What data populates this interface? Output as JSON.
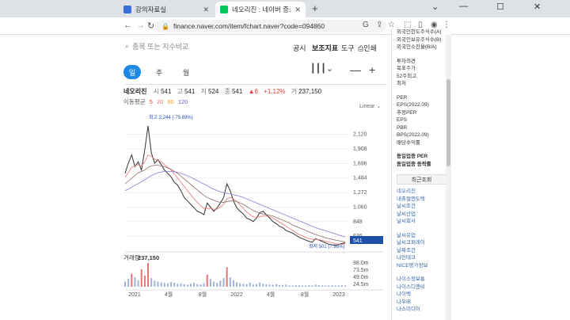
{
  "browser": {
    "tabs": [
      {
        "label": "강의자료실",
        "icon_color": "#3b6fd8",
        "active": false
      },
      {
        "label": "네오리진 : 네이버 증권",
        "icon_color": "#03c75a",
        "active": true
      }
    ],
    "new_tab": "+",
    "url": "finance.naver.com/item/fchart.naver?code=094860"
  },
  "header": {
    "search_placeholder": "종목 또는 지수비교",
    "menu": [
      "공시",
      "보조지표",
      "도구",
      "인쇄"
    ],
    "periods": [
      "일",
      "주",
      "월"
    ],
    "active_period": "일"
  },
  "stock": {
    "name": "네오리진",
    "open_k": "시",
    "open_v": "541",
    "high_k": "고",
    "high_v": "541",
    "low_k": "저",
    "low_v": "524",
    "close_k": "종",
    "close_v": "541",
    "change": "▲6",
    "change_pct": "+1.12%",
    "vol_k": "거",
    "vol_v": "237,150"
  },
  "ma": {
    "label": "이동평균",
    "items": [
      "5",
      "20",
      "60",
      "120"
    ]
  },
  "scale_label": "Linear",
  "chart_data": {
    "type": "line",
    "title": "",
    "price_ticks": [
      2120,
      1908,
      1696,
      1484,
      1272,
      1060,
      848,
      636
    ],
    "current_price": "541",
    "max_annotation": "최고 2,244 (-75.89%)",
    "min_annotation": "최저 501 (7.98%)",
    "x_ticks": [
      "2021",
      "4월",
      "8월",
      "2022",
      "4월",
      "8월",
      "2023"
    ],
    "volume_label": "거래량",
    "volume_value": "237,150",
    "volume_ticks": [
      "98.0m",
      "73.5m",
      "49.0m",
      "24.5m"
    ],
    "ylim": [
      500,
      2300
    ],
    "series": [
      {
        "color": "#333333",
        "values": [
          1550,
          1700,
          1820,
          1650,
          1720,
          1600,
          1900,
          2244,
          1850,
          1700,
          1750,
          1680,
          1600,
          1550,
          1500,
          1420,
          1380,
          1300,
          1200,
          1150,
          1100,
          1050,
          1000,
          980,
          950,
          1120,
          1060,
          1000,
          1050,
          1120,
          1200,
          1400,
          1300,
          1150,
          1050,
          1000,
          960,
          900,
          880,
          850,
          900,
          980,
          1000,
          950,
          900,
          850,
          820,
          780,
          760,
          720,
          700,
          680,
          650,
          620,
          600,
          580,
          560,
          550,
          600,
          580,
          560,
          540,
          520,
          510,
          501,
          520,
          530,
          541
        ]
      },
      {
        "color": "#e57373",
        "values": [
          1500,
          1560,
          1640,
          1660,
          1680,
          1660,
          1720,
          1820,
          1800,
          1760,
          1740,
          1720,
          1680,
          1640,
          1600,
          1540,
          1480,
          1420,
          1360,
          1300,
          1240,
          1180,
          1130,
          1080,
          1040,
          1040,
          1040,
          1030,
          1030,
          1060,
          1100,
          1180,
          1200,
          1180,
          1140,
          1090,
          1040,
          990,
          950,
          920,
          910,
          920,
          930,
          930,
          920,
          900,
          870,
          840,
          810,
          780,
          750,
          720,
          690,
          660,
          640,
          620,
          600,
          590,
          590,
          585,
          575,
          565,
          552,
          540,
          528,
          522,
          520,
          525
        ]
      },
      {
        "color": "#8d6e63",
        "values": [
          1400,
          1440,
          1480,
          1520,
          1560,
          1580,
          1600,
          1640,
          1660,
          1670,
          1670,
          1660,
          1650,
          1630,
          1610,
          1580,
          1550,
          1510,
          1470,
          1430,
          1390,
          1350,
          1310,
          1270,
          1230,
          1200,
          1180,
          1160,
          1140,
          1130,
          1130,
          1140,
          1150,
          1150,
          1140,
          1120,
          1100,
          1070,
          1040,
          1010,
          990,
          970,
          960,
          950,
          940,
          930,
          910,
          890,
          870,
          850,
          830,
          800,
          780,
          760,
          740,
          720,
          700,
          680,
          660,
          645,
          630,
          615,
          600,
          590,
          580,
          570,
          562,
          556
        ]
      },
      {
        "color": "#9575cd",
        "values": [
          1300,
          1320,
          1350,
          1380,
          1400,
          1430,
          1460,
          1490,
          1520,
          1540,
          1560,
          1570,
          1580,
          1580,
          1580,
          1575,
          1565,
          1550,
          1535,
          1515,
          1495,
          1470,
          1445,
          1420,
          1395,
          1370,
          1345,
          1320,
          1300,
          1285,
          1270,
          1260,
          1250,
          1240,
          1230,
          1215,
          1200,
          1180,
          1160,
          1140,
          1120,
          1100,
          1080,
          1060,
          1040,
          1020,
          1000,
          980,
          960,
          940,
          920,
          900,
          880,
          860,
          840,
          820,
          800,
          780,
          760,
          745,
          730,
          715,
          700,
          685,
          670,
          655,
          640,
          625
        ]
      }
    ],
    "volume": [
      12,
      18,
      30,
      22,
      15,
      40,
      26,
      55,
      20,
      14,
      12,
      10,
      9,
      8,
      11,
      9,
      7,
      8,
      6,
      5,
      7,
      9,
      6,
      5,
      8,
      28,
      18,
      12,
      9,
      14,
      20,
      45,
      22,
      15,
      10,
      8,
      7,
      6,
      9,
      5,
      6,
      10,
      7,
      6,
      5,
      5,
      6,
      4,
      4,
      5,
      3,
      3,
      4,
      4,
      3,
      3,
      4,
      3,
      5,
      4,
      3,
      3,
      3,
      4,
      3,
      3,
      4,
      3
    ]
  },
  "side_panel": {
    "group1": [
      "외국인한도주식수(A)",
      "외국인보유주식수(B)",
      "외국인소진율(B/A)"
    ],
    "group2": [
      "투자의견",
      "목표주가",
      "52주최고",
      "최저"
    ],
    "group3": [
      "PER",
      "EPS(2022.09)",
      "추정PER",
      "EPS",
      "PBR",
      "BPS(2022.09)",
      "배당수익률"
    ],
    "group4": [
      "동일업종 PER",
      "동일업종 등락률"
    ],
    "recent_header": "최근조회",
    "recent_a": [
      "네오리진",
      "내츄럴엔도텍",
      "날씨조건",
      "날씨산업",
      "날씨회사"
    ],
    "recent_b": [
      "날씨유업",
      "날씨코퍼레이",
      "날짜조건",
      "나인테크",
      "NICE평가정보"
    ],
    "recent_c": [
      "나이스정보통",
      "나이스디앤비",
      "나이벡",
      "나우IB",
      "나스미디어"
    ]
  }
}
